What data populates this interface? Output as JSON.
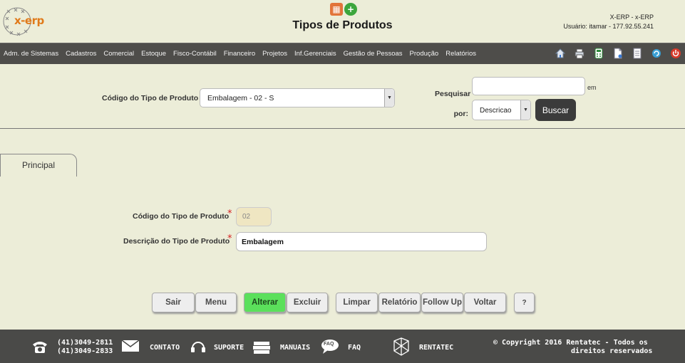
{
  "header": {
    "logo_text": "x-erp",
    "title": "Tipos de Produtos",
    "system": "X-ERP - x-ERP",
    "user": "Usuário: itamar - 177.92.55.241"
  },
  "nav": {
    "items": [
      "Adm. de Sistemas",
      "Cadastros",
      "Comercial",
      "Estoque",
      "Fisco-Contábil",
      "Financeiro",
      "Projetos",
      "Inf.Gerenciais",
      "Gestão de Pessoas",
      "Produção",
      "Relatórios"
    ],
    "icons": [
      "home-icon",
      "print-icon",
      "calculator-icon",
      "document-icon",
      "notes-icon",
      "refresh-icon",
      "power-icon"
    ]
  },
  "search": {
    "code_label": "Código do Tipo de Produto",
    "code_selected": "Embalagem - 02 - S",
    "pesquisar_label_1": "Pesquisar",
    "pesquisar_label_2": "por:",
    "em_label": "em",
    "field_value": "",
    "by_selected": "Descricao",
    "search_button": "Buscar"
  },
  "tabs": {
    "principal": "Principal"
  },
  "form": {
    "code_label": "Código do Tipo de Produto",
    "code_value": "02",
    "desc_label": "Descrição do Tipo de Produto",
    "desc_value": "Embalagem",
    "required_mark": "*"
  },
  "actions": {
    "sair": "Sair",
    "menu": "Menu",
    "alterar": "Alterar",
    "excluir": "Excluir",
    "limpar": "Limpar",
    "relatorio": "Relatório",
    "followup": "Follow Up",
    "voltar": "Voltar",
    "help": "?"
  },
  "footer": {
    "phone1": "(41)3049-2811",
    "phone2": "(41)3049-2833",
    "contato": "CONTATO",
    "suporte": "SUPORTE",
    "manuais": "MANUAIS",
    "faq_badge": "FAQ",
    "faq": "FAQ",
    "rentatec": "RENTATEC",
    "copyright1": "© Copyright 2016 Rentatec - Todos os",
    "copyright2": "direitos reservados"
  },
  "colors": {
    "background": "#ecedd8",
    "nav": "#4e4d4a",
    "accent_green": "#5be05b",
    "required": "#d62020"
  }
}
